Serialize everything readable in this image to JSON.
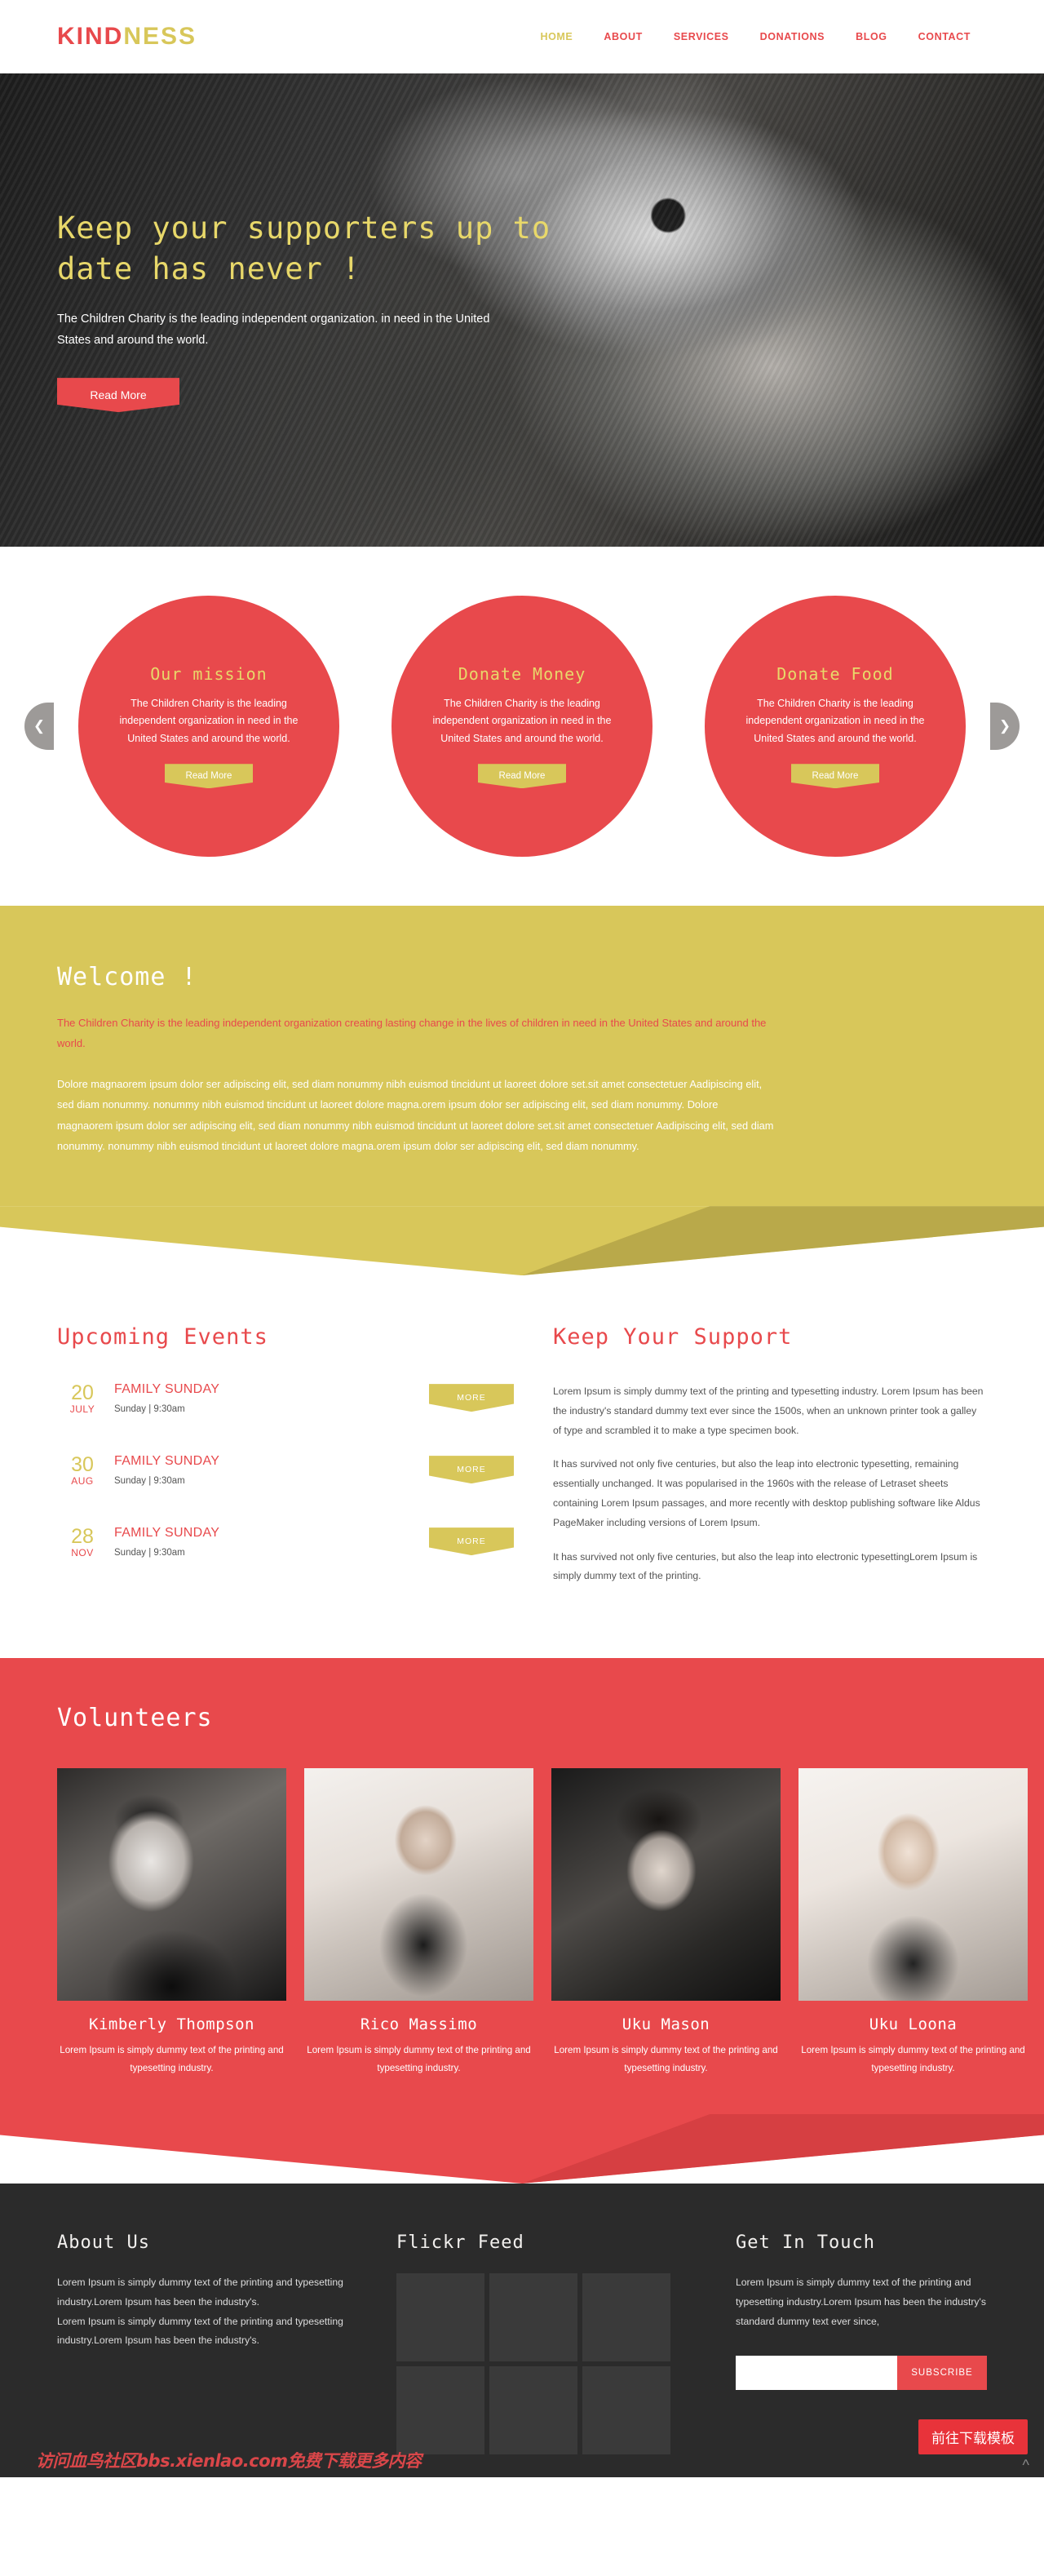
{
  "brand": {
    "part1": "KIND",
    "part2": "NESS",
    "kind_color": "#e8494c",
    "ness_color": "#d8c75a"
  },
  "nav": [
    {
      "label": "HOME",
      "active": true
    },
    {
      "label": "ABOUT",
      "active": false
    },
    {
      "label": "SERVICES",
      "active": false
    },
    {
      "label": "DONATIONS",
      "active": false
    },
    {
      "label": "BLOG",
      "active": false
    },
    {
      "label": "CONTACT",
      "active": false
    }
  ],
  "hero": {
    "heading": "Keep your supporters up to date has never !",
    "paragraph": "The Children Charity is the leading independent organization. in need in the United States and around the world.",
    "button": "Read More"
  },
  "carousel": {
    "prev_icon": "chevron-left-icon",
    "next_icon": "chevron-right-icon",
    "cards": [
      {
        "title": "Our mission",
        "text": "The Children Charity is the leading independent organization in need in the United States and around the world.",
        "button": "Read More"
      },
      {
        "title": "Donate Money",
        "text": "The Children Charity is the leading independent organization in need in the United States and around the world.",
        "button": "Read More"
      },
      {
        "title": "Donate Food",
        "text": "The Children Charity is the leading independent organization in need in the United States and around the world.",
        "button": "Read More"
      }
    ]
  },
  "welcome": {
    "title": "Welcome !",
    "lead": "The Children Charity is the leading independent organization creating lasting change in the lives of children in need in the United States and around the world.",
    "body": "Dolore magnaorem ipsum dolor ser adipiscing elit, sed diam nonummy nibh euismod tincidunt ut laoreet dolore set.sit amet consectetuer Aadipiscing elit, sed diam nonummy. nonummy nibh euismod tincidunt ut laoreet dolore magna.orem ipsum dolor ser adipiscing elit, sed diam nonummy. Dolore magnaorem ipsum dolor ser adipiscing elit, sed diam nonummy nibh euismod tincidunt ut laoreet dolore set.sit amet consectetuer Aadipiscing elit, sed diam nonummy. nonummy nibh euismod tincidunt ut laoreet dolore magna.orem ipsum dolor ser adipiscing elit, sed diam nonummy."
  },
  "events": {
    "title": "Upcoming Events",
    "items": [
      {
        "day": "20",
        "month": "JULY",
        "name": "FAMILY SUNDAY",
        "when": "Sunday | 9:30am",
        "button": "MORE"
      },
      {
        "day": "30",
        "month": "AUG",
        "name": "FAMILY SUNDAY",
        "when": "Sunday | 9:30am",
        "button": "MORE"
      },
      {
        "day": "28",
        "month": "NOV",
        "name": "FAMILY SUNDAY",
        "when": "Sunday | 9:30am",
        "button": "MORE"
      }
    ]
  },
  "support": {
    "title": "Keep Your Support",
    "p1": "Lorem Ipsum is simply dummy text of the printing and typesetting industry. Lorem Ipsum has been the industry's standard dummy text ever since the 1500s, when an unknown printer took a galley of type and scrambled it to make a type specimen book.",
    "p2": "It has survived not only five centuries, but also the leap into electronic typesetting, remaining essentially unchanged. It was popularised in the 1960s with the release of Letraset sheets containing Lorem Ipsum passages, and more recently with desktop publishing software like Aldus PageMaker including versions of Lorem Ipsum.",
    "p3": "It has survived not only five centuries, but also the leap into electronic typesettingLorem Ipsum is simply dummy text of the printing."
  },
  "volunteers": {
    "title": "Volunteers",
    "people": [
      {
        "name": "Kimberly Thompson",
        "bio": "Lorem Ipsum is simply dummy text of the printing and typesetting industry."
      },
      {
        "name": "Rico Massimo",
        "bio": "Lorem Ipsum is simply dummy text of the printing and typesetting industry."
      },
      {
        "name": "Uku Mason",
        "bio": "Lorem Ipsum is simply dummy text of the printing and typesetting industry."
      },
      {
        "name": "Uku Loona",
        "bio": "Lorem Ipsum is simply dummy text of the printing and typesetting industry."
      }
    ]
  },
  "footer": {
    "about": {
      "title": "About Us",
      "p1": "Lorem Ipsum is simply dummy text of the printing and typesetting industry.Lorem Ipsum has been the industry's.",
      "p2": "Lorem Ipsum is simply dummy text of the printing and typesetting industry.Lorem Ipsum has been the industry's."
    },
    "flickr": {
      "title": "Flickr Feed",
      "count": 6
    },
    "touch": {
      "title": "Get In Touch",
      "text": "Lorem Ipsum is simply dummy text of the printing and typesetting industry.Lorem Ipsum has been the industry's standard dummy text ever since,",
      "input_value": "",
      "input_placeholder": "",
      "button": "SUBSCRIBE"
    },
    "cn_badge": "前往下载模板",
    "watermark": "访问血鸟社区bbs.xienlao.com免费下载更多内容",
    "scroll_top_icon": "chevron-up-icon"
  },
  "colors": {
    "red": "#e8494c",
    "yellow": "#d8c75a",
    "dark": "#2b2b2b"
  }
}
